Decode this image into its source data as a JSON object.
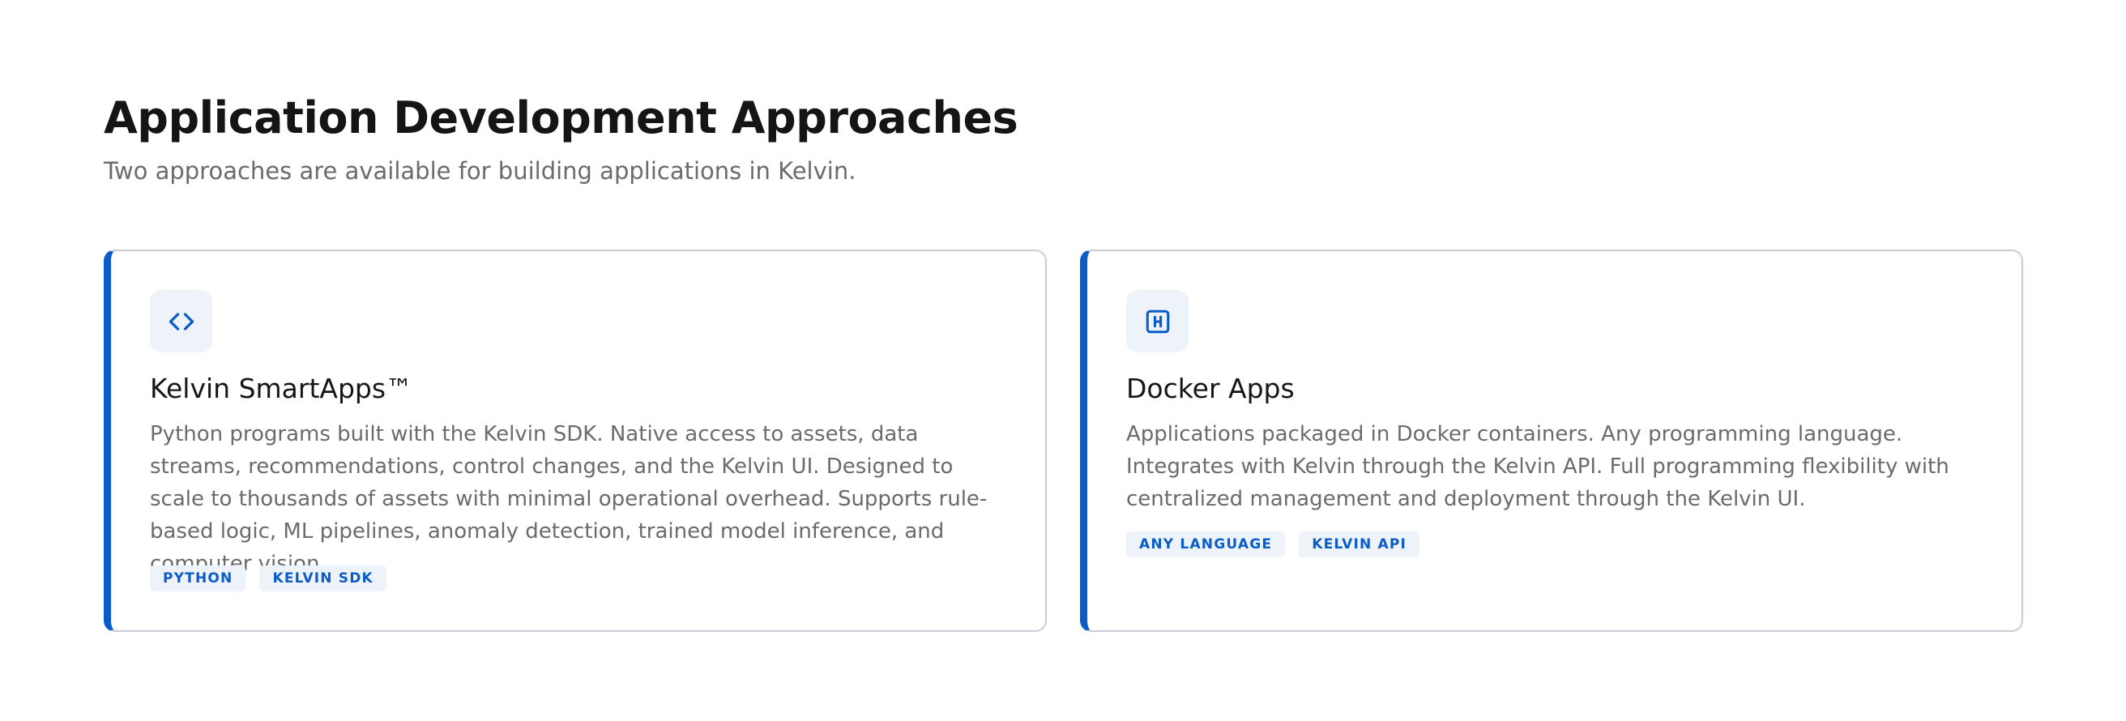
{
  "header": {
    "title": "Application Development Approaches",
    "subtitle": "Two approaches are available for building applications in Kelvin."
  },
  "cards": [
    {
      "icon": "code-icon",
      "title": "Kelvin SmartApps™",
      "description": "Python programs built with the Kelvin SDK. Native access to assets, data streams, recommendations, control changes, and the Kelvin UI. Designed to scale to thousands of assets with minimal operational overhead. Supports rule-based logic, ML pipelines, anomaly detection, trained model inference, and computer vision.",
      "tags": [
        "PYTHON",
        "KELVIN SDK"
      ]
    },
    {
      "icon": "docker-container-icon",
      "title": "Docker Apps",
      "description": "Applications packaged in Docker containers. Any programming language. Integrates with Kelvin through the Kelvin API. Full programming flexibility with centralized management and deployment through the Kelvin UI.",
      "tags": [
        "ANY LANGUAGE",
        "KELVIN API"
      ]
    }
  ],
  "colors": {
    "accent": "#0a5cc8",
    "tag_background": "#eef3fa",
    "card_border": "#c9ccd6",
    "muted_text": "#6b6b6b"
  }
}
